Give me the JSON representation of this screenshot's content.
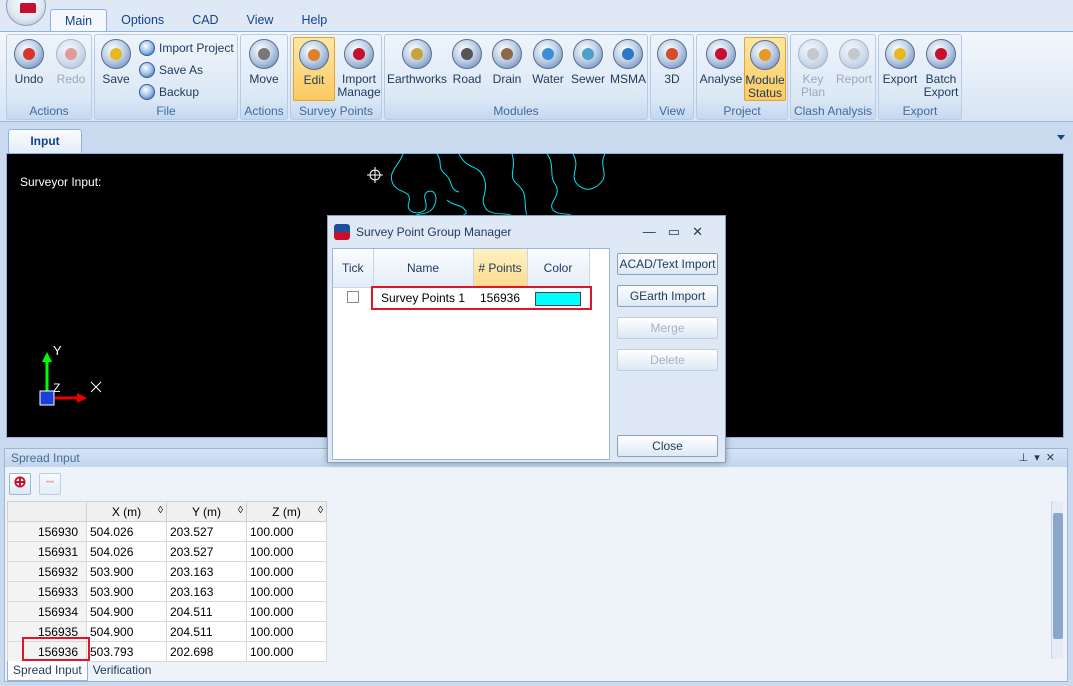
{
  "tabs": [
    "Main",
    "Options",
    "CAD",
    "View",
    "Help"
  ],
  "ribbon": {
    "groups": {
      "actions1": "Actions",
      "file": "File",
      "actions2": "Actions",
      "survey_points": "Survey Points",
      "modules": "Modules",
      "view": "View",
      "project": "Project",
      "clash": "Clash Analysis",
      "export": "Export"
    },
    "buttons": {
      "undo": "Undo",
      "redo": "Redo",
      "save": "Save",
      "import_project": "Import Project",
      "save_as": "Save As",
      "backup": "Backup",
      "move": "Move",
      "edit": "Edit",
      "import": "Import",
      "manage": "Manage",
      "earthworks": "Earthworks",
      "road": "Road",
      "drain": "Drain",
      "water": "Water",
      "sewer": "Sewer",
      "msma": "MSMA",
      "view3d": "3D",
      "analyse": "Analyse",
      "module": "Module",
      "status": "Status",
      "key": "Key",
      "plan": "Plan",
      "report": "Report",
      "export": "Export",
      "batch": "Batch",
      "export2": "Export"
    }
  },
  "doc_tab": "Input",
  "canvas": {
    "label": "Surveyor Input:",
    "axis_y": "Y",
    "axis_z": "Z",
    "axis_x": "X"
  },
  "spread": {
    "title": "Spread Input",
    "columns": [
      "X (m)",
      "Y (m)",
      "Z (m)"
    ],
    "rows": [
      {
        "id": "156930",
        "x": "504.026",
        "y": "203.527",
        "z": "100.000"
      },
      {
        "id": "156931",
        "x": "504.026",
        "y": "203.527",
        "z": "100.000"
      },
      {
        "id": "156932",
        "x": "503.900",
        "y": "203.163",
        "z": "100.000"
      },
      {
        "id": "156933",
        "x": "503.900",
        "y": "203.163",
        "z": "100.000"
      },
      {
        "id": "156934",
        "x": "504.900",
        "y": "204.511",
        "z": "100.000"
      },
      {
        "id": "156935",
        "x": "504.900",
        "y": "204.511",
        "z": "100.000"
      },
      {
        "id": "156936",
        "x": "503.793",
        "y": "202.698",
        "z": "100.000"
      }
    ],
    "bottom_tabs": [
      "Spread Input",
      "Verification"
    ]
  },
  "dialog": {
    "title": "Survey Point Group Manager",
    "columns": {
      "tick": "Tick",
      "name": "Name",
      "points": "# Points",
      "color": "Color"
    },
    "group": {
      "name": "Survey Points 1",
      "points": "156936",
      "color": "#00ffff"
    },
    "buttons": {
      "acad": "ACAD/Text Import",
      "gearth": "GEarth Import",
      "merge": "Merge",
      "delete": "Delete",
      "close": "Close"
    }
  },
  "colors": {
    "accent": "#15428b",
    "highlight_box": "#e0152a",
    "contour": "#00e5ee"
  }
}
